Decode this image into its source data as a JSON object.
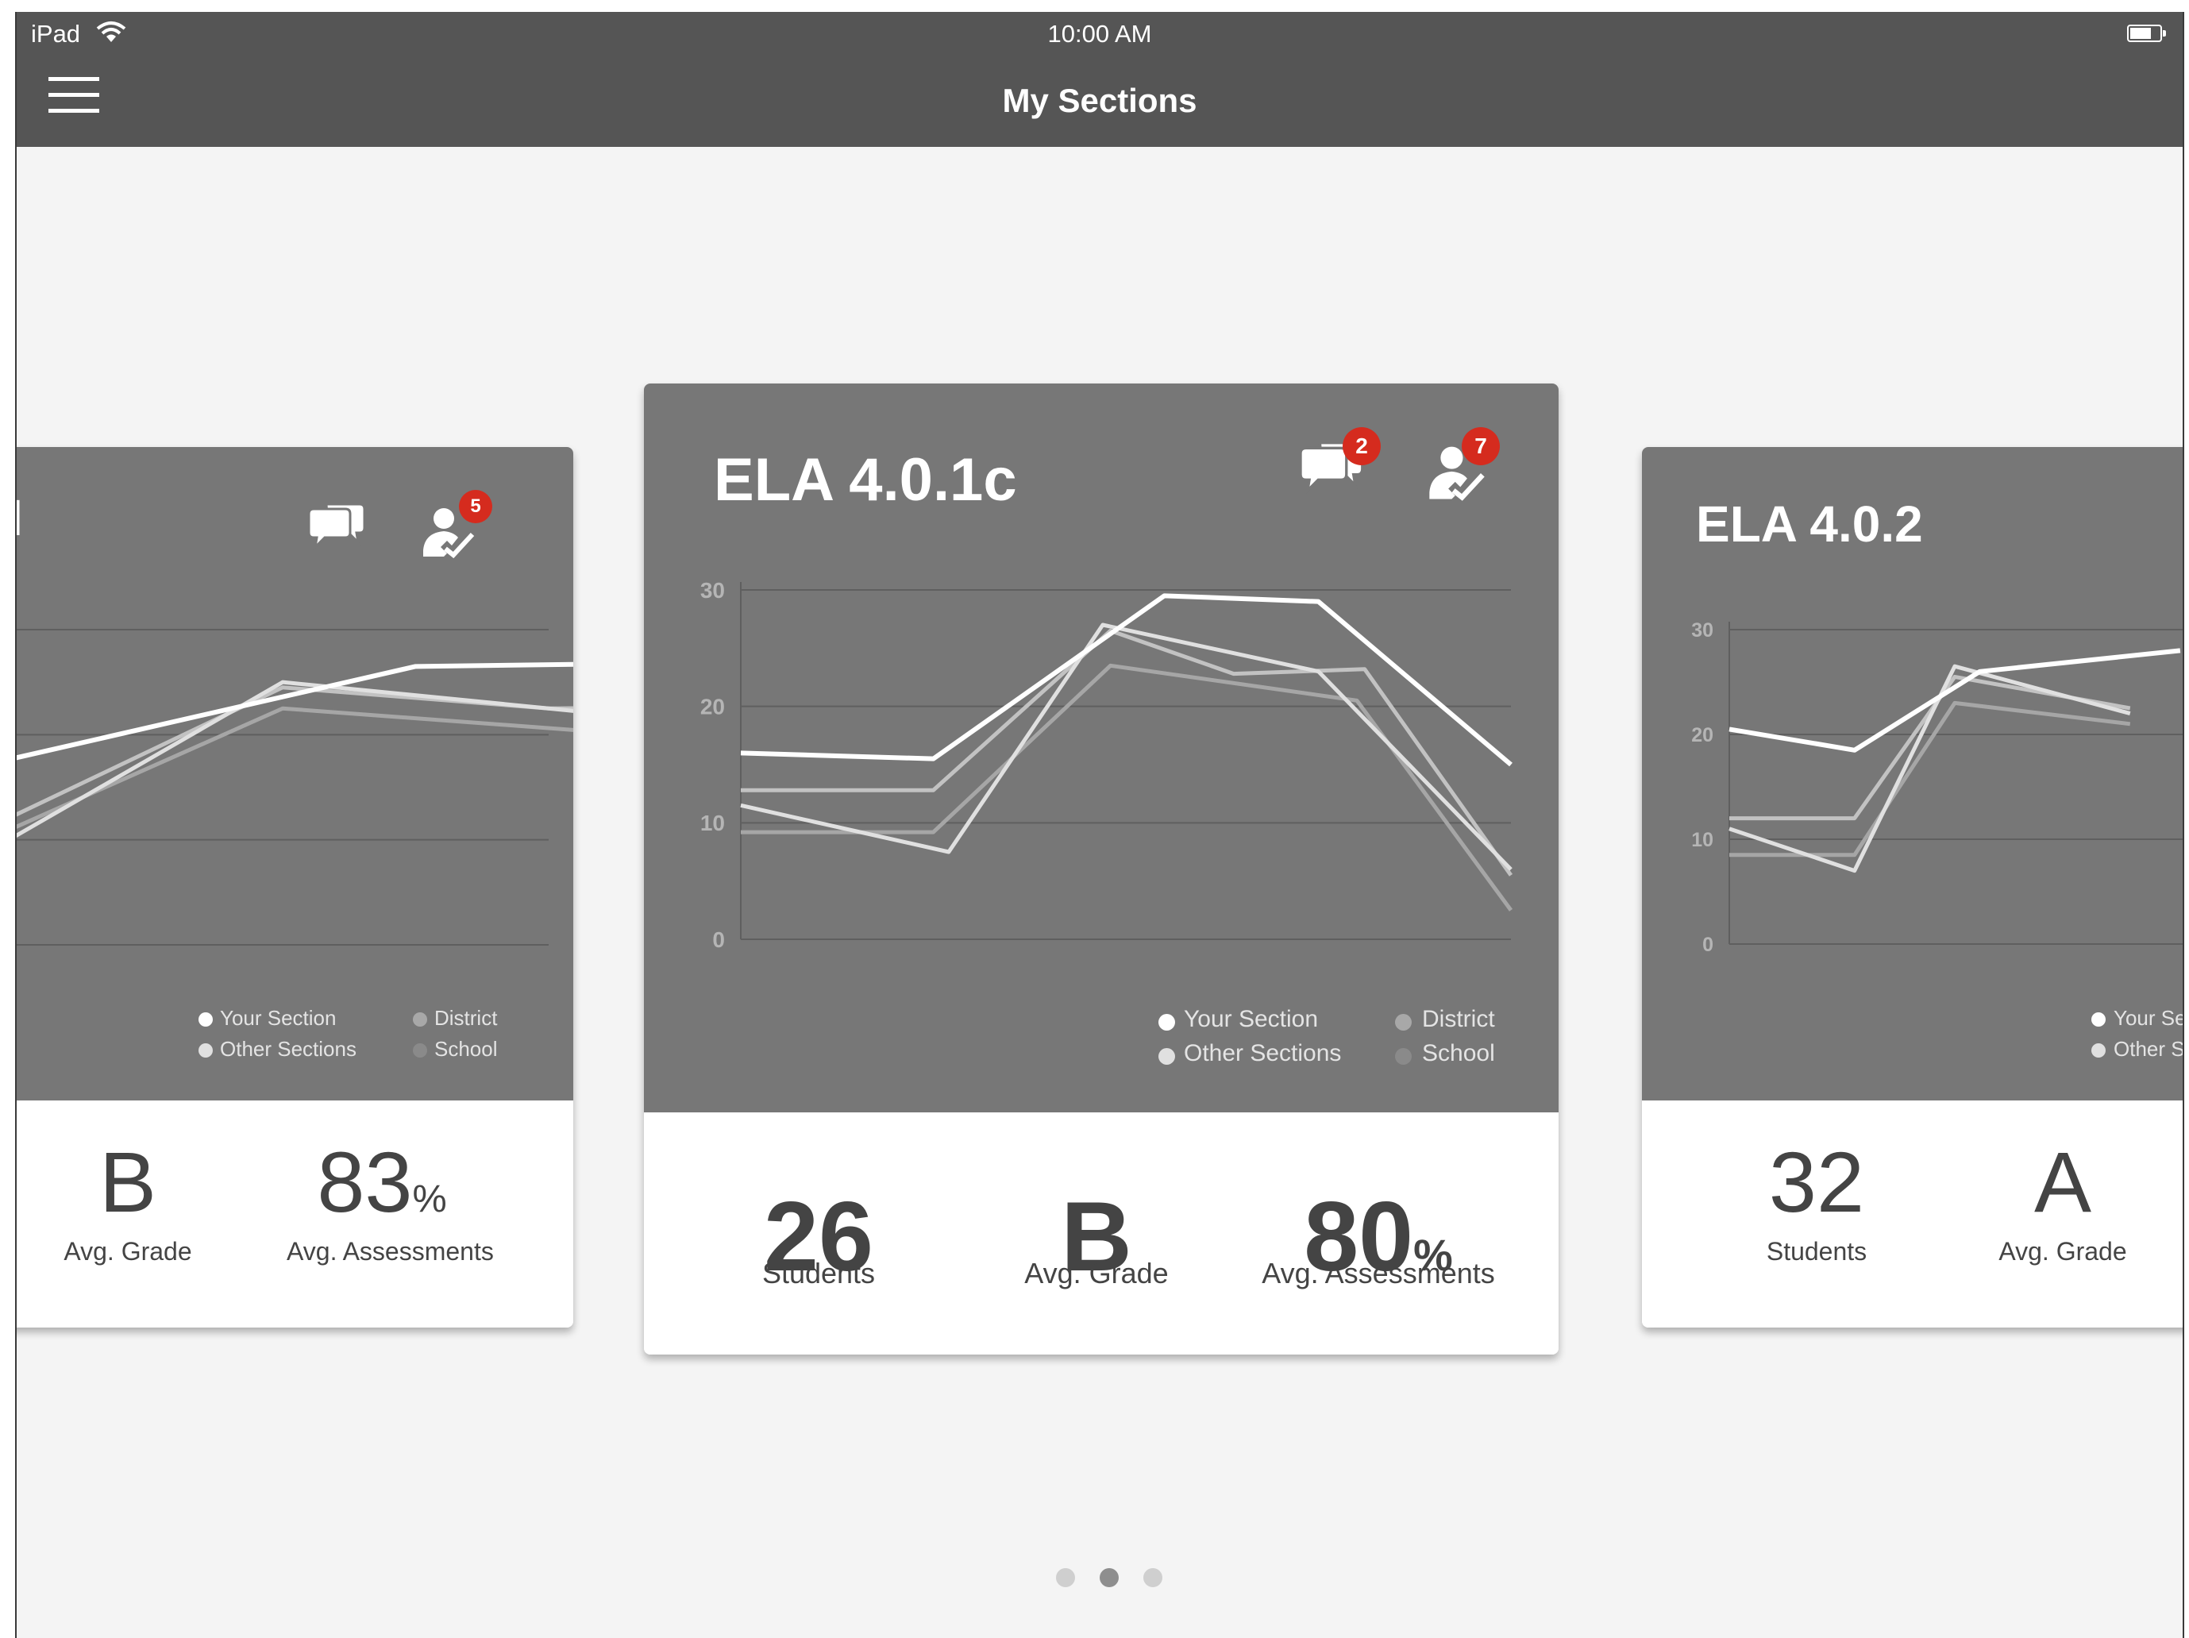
{
  "status_bar": {
    "carrier": "iPad",
    "time": "10:00 AM"
  },
  "header": {
    "title": "My Sections",
    "menu_icon": "hamburger-icon"
  },
  "legend": {
    "your_section": "Your Section",
    "other_sections": "Other Sections",
    "district": "District",
    "school": "School"
  },
  "cards": {
    "left": {
      "title": "I",
      "message_badge": "",
      "roster_badge": "5",
      "stats": {
        "grade_value": "B",
        "grade_label": "Avg. Grade",
        "assess_value": "83",
        "assess_unit": "%",
        "assess_label": "Avg. Assessments"
      }
    },
    "center": {
      "title": "ELA 4.0.1c",
      "message_badge": "2",
      "roster_badge": "7",
      "stats": {
        "students_value": "26",
        "students_label": "Students",
        "grade_value": "B",
        "grade_label": "Avg. Grade",
        "assess_value": "80",
        "assess_unit": "%",
        "assess_label": "Avg. Assessments"
      }
    },
    "right": {
      "title": "ELA 4.0.2",
      "legend_your_section": "Your Se",
      "legend_other_sections": "Other S",
      "stats": {
        "students_value": "32",
        "students_label": "Students",
        "grade_value": "A",
        "grade_label": "Avg. Grade"
      }
    }
  },
  "chart_data": [
    {
      "type": "line",
      "ylim": [
        0,
        30
      ],
      "yticks": [],
      "series": [
        {
          "name": "Your Section",
          "color": "#ffffff",
          "points": [
            [
              -0.2,
              15.5
            ],
            [
              0.75,
              26.5
            ],
            [
              1.5,
              27
            ],
            [
              2.2,
              14
            ]
          ]
        },
        {
          "name": "Other Sections",
          "color": "#e0e0e0",
          "points": [
            [
              -0.1,
              7.5
            ],
            [
              0.5,
              25
            ],
            [
              1.2,
              21.5
            ],
            [
              2.4,
              4.5
            ]
          ]
        },
        {
          "name": "District",
          "color": "#c2c2c2",
          "points": [
            [
              -0.1,
              10
            ],
            [
              0.5,
              24.5
            ],
            [
              1,
              22.5
            ],
            [
              1.6,
              22.8
            ],
            [
              2.4,
              4.5
            ]
          ]
        },
        {
          "name": "School",
          "color": "#a6a6a6",
          "points": [
            [
              -0.1,
              9
            ],
            [
              0.5,
              22.5
            ],
            [
              1.3,
              19.5
            ],
            [
              2.4,
              2
            ]
          ]
        }
      ]
    },
    {
      "type": "line",
      "ylim": [
        0,
        30
      ],
      "yticks": [
        "0",
        "10",
        "20",
        "30"
      ],
      "series": [
        {
          "name": "Your Section",
          "color": "#ffffff",
          "points": [
            [
              0,
              16
            ],
            [
              0.25,
              15.5
            ],
            [
              0.55,
              29.5
            ],
            [
              0.75,
              29
            ],
            [
              1,
              15
            ]
          ]
        },
        {
          "name": "Other Sections",
          "color": "#e0e0e0",
          "points": [
            [
              0,
              11.5
            ],
            [
              0.27,
              7.5
            ],
            [
              0.47,
              27
            ],
            [
              0.75,
              23
            ],
            [
              1,
              6
            ]
          ]
        },
        {
          "name": "District",
          "color": "#c2c2c2",
          "points": [
            [
              0,
              12.8
            ],
            [
              0.25,
              12.8
            ],
            [
              0.48,
              26.5
            ],
            [
              0.64,
              22.8
            ],
            [
              0.81,
              23.2
            ],
            [
              1,
              5.5
            ]
          ]
        },
        {
          "name": "School",
          "color": "#a6a6a6",
          "points": [
            [
              0,
              9.2
            ],
            [
              0.25,
              9.2
            ],
            [
              0.48,
              23.5
            ],
            [
              0.8,
              20.5
            ],
            [
              1,
              2.5
            ]
          ]
        }
      ]
    },
    {
      "type": "line",
      "ylim": [
        0,
        30
      ],
      "yticks": [
        "0",
        "10",
        "20",
        "30"
      ],
      "series": [
        {
          "name": "Your Section",
          "color": "#ffffff",
          "points": [
            [
              0,
              20.5
            ],
            [
              0.25,
              18.5
            ],
            [
              0.5,
              26
            ],
            [
              0.9,
              28
            ]
          ]
        },
        {
          "name": "Other Sections",
          "color": "#e0e0e0",
          "points": [
            [
              0,
              11
            ],
            [
              0.25,
              7
            ],
            [
              0.45,
              26.5
            ],
            [
              0.8,
              22
            ]
          ]
        },
        {
          "name": "District",
          "color": "#c2c2c2",
          "points": [
            [
              0,
              12
            ],
            [
              0.25,
              12
            ],
            [
              0.45,
              25.5
            ],
            [
              0.8,
              22.5
            ]
          ]
        },
        {
          "name": "School",
          "color": "#a6a6a6",
          "points": [
            [
              0,
              8.5
            ],
            [
              0.25,
              8.5
            ],
            [
              0.45,
              23
            ],
            [
              0.8,
              21
            ]
          ]
        }
      ]
    }
  ]
}
